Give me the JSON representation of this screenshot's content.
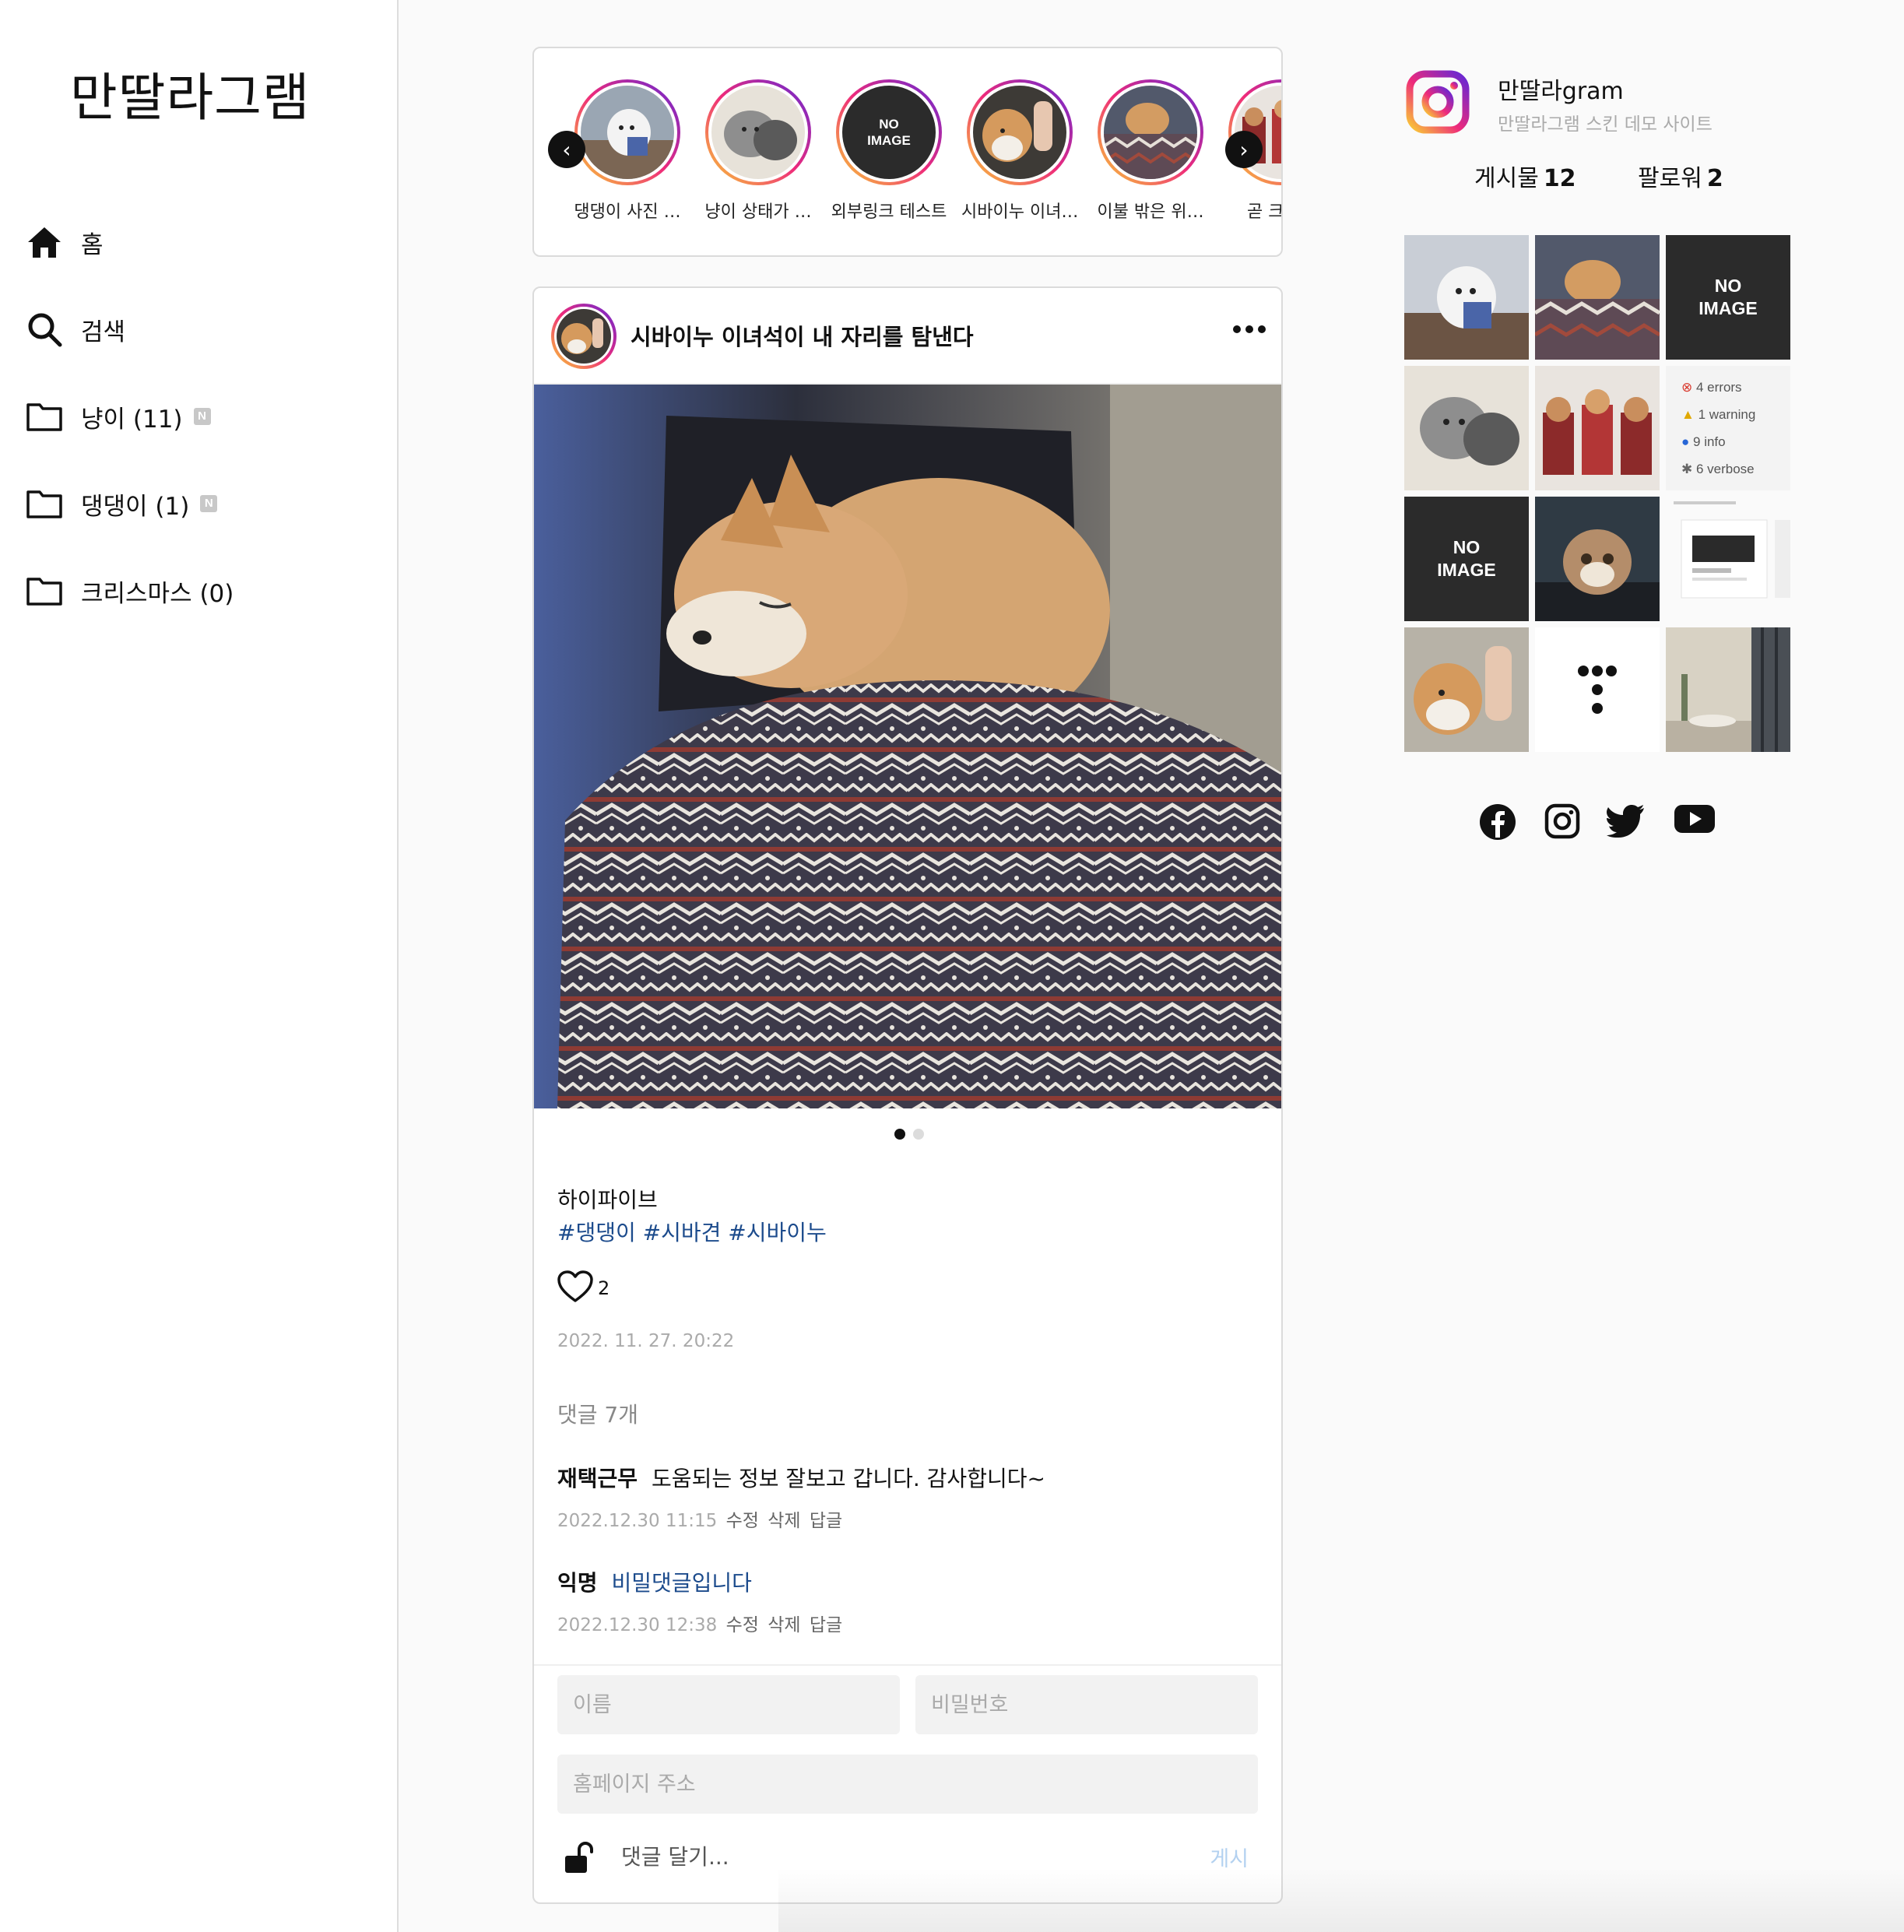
{
  "sidebar": {
    "logo": "만딸라그램",
    "items": [
      {
        "label": "홈",
        "icon": "home-icon"
      },
      {
        "label": "검색",
        "icon": "search-icon"
      },
      {
        "label": "냥이 (11)",
        "icon": "folder-icon",
        "badge": "N"
      },
      {
        "label": "댕댕이 (1)",
        "icon": "folder-icon",
        "badge": "N"
      },
      {
        "label": "크리스마스 (0)",
        "icon": "folder-icon"
      }
    ]
  },
  "stories": {
    "items": [
      {
        "label": "댕댕이 사진 …"
      },
      {
        "label": "냥이 상태가 …"
      },
      {
        "label": "외부링크 테스트",
        "noimage": "NO IMAGE"
      },
      {
        "label": "시바이누 이녀…"
      },
      {
        "label": "이불 밖은 위…"
      },
      {
        "label": "곧 크리스"
      }
    ]
  },
  "post": {
    "title": "시바이누 이녀석이 내 자리를 탐낸다",
    "caption": "하이파이브",
    "tags": "#댕댕이 #시바견 #시바이누",
    "likes": "2",
    "date": "2022. 11. 27. 20:22",
    "comment_count": "댓글 7개",
    "comments": [
      {
        "author": "재택근무",
        "text": "도움되는 정보 잘보고 갑니다. 감사합니다~",
        "time": "2022.12.30 11:15",
        "edit": "수정",
        "delete": "삭제",
        "reply": "답글"
      },
      {
        "author": "익명",
        "text": "비밀댓글입니다",
        "time": "2022.12.30 12:38",
        "edit": "수정",
        "delete": "삭제",
        "reply": "답글"
      }
    ],
    "form": {
      "name_placeholder": "이름",
      "password_placeholder": "비밀번호",
      "homepage_placeholder": "홈페이지 주소",
      "comment_placeholder": "댓글 달기...",
      "submit": "게시"
    }
  },
  "profile": {
    "name": "만딸라gram",
    "desc": "만딸라그램 스킨 데모 사이트",
    "posts_label": "게시물",
    "posts_count": "12",
    "followers_label": "팔로워",
    "followers_count": "2"
  },
  "grid": {
    "noimage_line1": "NO",
    "noimage_line2": "IMAGE",
    "log_lines": [
      "4 errors",
      "1 warning",
      "9 info",
      "6 verbose"
    ]
  },
  "social": [
    "facebook-icon",
    "instagram-icon",
    "twitter-icon",
    "youtube-icon"
  ],
  "colors": {
    "tag": "#1c4b8c",
    "submit": "#b3d1f0",
    "muted": "#aaaaaa"
  }
}
